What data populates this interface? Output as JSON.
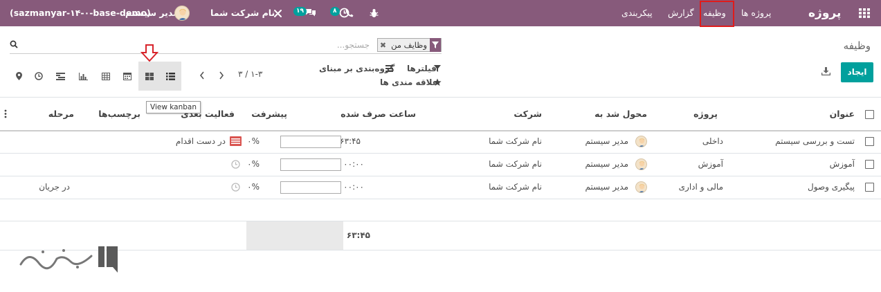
{
  "topbar": {
    "brand": "پروژه",
    "menu": [
      "پروژه ها",
      "وظیفه",
      "گزارش",
      "پیکربندی"
    ],
    "company": "نام شرکت شما",
    "user": "مدیر سیستم",
    "db": "(sazmanyar-۱۴-۰-base-demo)",
    "activity_count": "۸",
    "messages_count": "۱۹",
    "icons": [
      "apps-grid-icon",
      "bug-icon",
      "phone-icon",
      "clock-icon",
      "chat-icon",
      "tools-icon"
    ]
  },
  "control": {
    "breadcrumb": "وظیفه",
    "create_label": "ایجاد",
    "search_placeholder": "جستجو...",
    "facet_label": "وظایف من",
    "filters_label": "فیلترها",
    "groupby_label": "گروه‌بندی بر مبنای",
    "favorites_label": "علاقه مندی ها",
    "pager": "۱-۳ / ۳",
    "tooltip": "View kanban",
    "views": [
      "list-view-icon",
      "kanban-view-icon",
      "calendar-view-icon",
      "pivot-view-icon",
      "graph-view-icon",
      "gantt-view-icon",
      "activity-view-icon",
      "map-view-icon"
    ]
  },
  "table": {
    "headers": {
      "title": "عنوان",
      "project": "پروژه",
      "assigned": "محول شد به",
      "company": "شرکت",
      "hours": "ساعت صرف شده",
      "progress": "پیشرفت",
      "activity": "فعالیت بعدی",
      "tags": "برچسب‌ها",
      "stage": "مرحله"
    },
    "rows": [
      {
        "title": "تست و بررسی سیستم",
        "project": "داخلی",
        "assigned": "مدیر سیستم",
        "company": "نام شرکت شما",
        "hours": "۶۳:۴۵",
        "progress": "۰%",
        "activity": "در دست اقدام",
        "stage": ""
      },
      {
        "title": "آموزش",
        "project": "آموزش",
        "assigned": "مدیر سیستم",
        "company": "نام شرکت شما",
        "hours": "۰۰:۰۰",
        "progress": "۰%",
        "activity": "",
        "stage": ""
      },
      {
        "title": "پیگیری وصول",
        "project": "مالی و اداری",
        "assigned": "مدیر سیستم",
        "company": "نام شرکت شما",
        "hours": "۰۰:۰۰",
        "progress": "۰%",
        "activity": "",
        "stage": "در جریان"
      }
    ],
    "total_hours": "۶۳:۴۵"
  },
  "colors": {
    "brand": "#875a7b",
    "accent": "#00a09d",
    "highlight": "#e01b1b"
  }
}
